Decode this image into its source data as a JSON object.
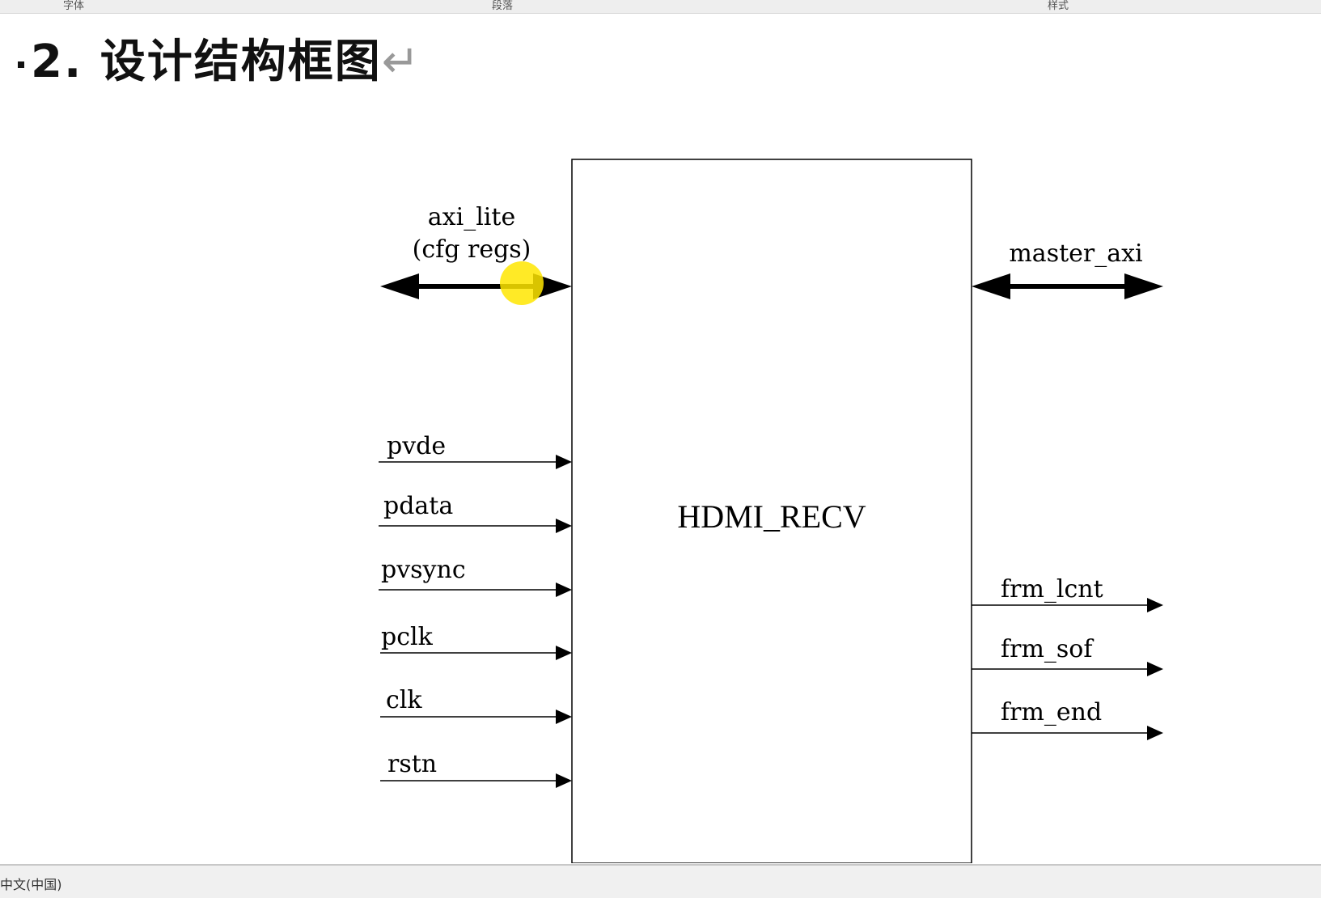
{
  "ribbon": {
    "group_font": "字体",
    "group_paragraph": "段落",
    "group_styles": "样式"
  },
  "document": {
    "heading_number": "2.",
    "heading_text": "设计结构框图",
    "pilcrow": "↵"
  },
  "diagram": {
    "block_label": "HDMI_RECV",
    "axi_lite_label": "axi_lite",
    "axi_lite_sub": "(cfg regs)",
    "master_axi_label": "master_axi",
    "inputs": [
      "pvde",
      "pdata",
      "pvsync",
      "pclk",
      "clk",
      "rstn"
    ],
    "outputs": [
      "frm_lcnt",
      "frm_sof",
      "frm_end"
    ]
  },
  "statusbar": {
    "text": "中文(中国)"
  }
}
